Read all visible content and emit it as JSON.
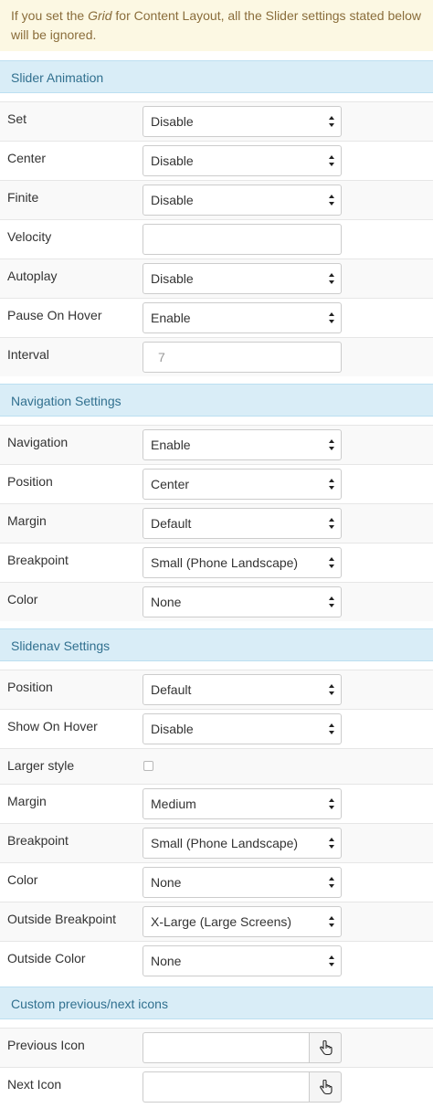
{
  "notice": {
    "prefix": "If you set the ",
    "emph": "Grid",
    "suffix": " for Content Layout, all the Slider settings stated below will be ignored."
  },
  "sections": {
    "slider_animation": "Slider Animation",
    "navigation_settings": "Navigation Settings",
    "slidenav_settings": "Slidenav Settings",
    "custom_icons": "Custom previous/next icons"
  },
  "slider": {
    "set": {
      "label": "Set",
      "value": "Disable"
    },
    "center": {
      "label": "Center",
      "value": "Disable"
    },
    "finite": {
      "label": "Finite",
      "value": "Disable"
    },
    "velocity": {
      "label": "Velocity",
      "value": ""
    },
    "autoplay": {
      "label": "Autoplay",
      "value": "Disable"
    },
    "pause_on_hover": {
      "label": "Pause On Hover",
      "value": "Enable"
    },
    "interval": {
      "label": "Interval",
      "placeholder": "7"
    }
  },
  "navigation": {
    "navigation": {
      "label": "Navigation",
      "value": "Enable"
    },
    "position": {
      "label": "Position",
      "value": "Center"
    },
    "margin": {
      "label": "Margin",
      "value": "Default"
    },
    "breakpoint": {
      "label": "Breakpoint",
      "value": "Small (Phone Landscape)"
    },
    "color": {
      "label": "Color",
      "value": "None"
    }
  },
  "slidenav": {
    "position": {
      "label": "Position",
      "value": "Default"
    },
    "show_on_hover": {
      "label": "Show On Hover",
      "value": "Disable"
    },
    "larger_style": {
      "label": "Larger style",
      "checked": false
    },
    "margin": {
      "label": "Margin",
      "value": "Medium"
    },
    "breakpoint": {
      "label": "Breakpoint",
      "value": "Small (Phone Landscape)"
    },
    "color": {
      "label": "Color",
      "value": "None"
    },
    "outside_breakpoint": {
      "label": "Outside Breakpoint",
      "value": "X-Large (Large Screens)"
    },
    "outside_color": {
      "label": "Outside Color",
      "value": "None"
    }
  },
  "icons": {
    "previous": {
      "label": "Previous Icon",
      "value": ""
    },
    "next": {
      "label": "Next Icon",
      "value": ""
    }
  }
}
